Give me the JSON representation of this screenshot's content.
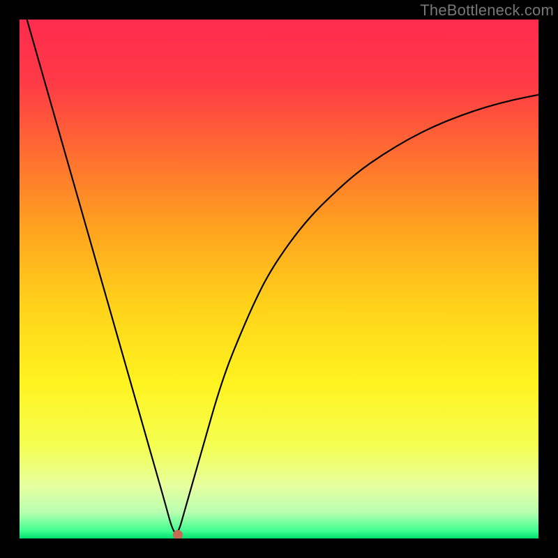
{
  "watermark": "TheBottleneck.com",
  "chart_data": {
    "type": "line",
    "title": "",
    "xlabel": "",
    "ylabel": "",
    "xlim": [
      0,
      100
    ],
    "ylim": [
      0,
      100
    ],
    "background_gradient": {
      "stops": [
        {
          "offset": 0.0,
          "color": "#ff2b4e"
        },
        {
          "offset": 0.12,
          "color": "#ff3a46"
        },
        {
          "offset": 0.25,
          "color": "#ff6a32"
        },
        {
          "offset": 0.4,
          "color": "#ffa21f"
        },
        {
          "offset": 0.55,
          "color": "#ffd21a"
        },
        {
          "offset": 0.7,
          "color": "#fff31f"
        },
        {
          "offset": 0.82,
          "color": "#f4ff50"
        },
        {
          "offset": 0.9,
          "color": "#e6ffa0"
        },
        {
          "offset": 0.95,
          "color": "#b8ffb0"
        },
        {
          "offset": 0.985,
          "color": "#40ff90"
        },
        {
          "offset": 1.0,
          "color": "#00e070"
        }
      ]
    },
    "series": [
      {
        "name": "bottleneck-curve",
        "color": "#000000",
        "stroke_width": 2.2,
        "x": [
          0,
          2,
          4,
          6,
          8,
          10,
          12,
          14,
          16,
          18,
          20,
          22,
          24,
          26,
          28,
          29.5,
          30.5,
          32,
          34,
          36,
          38,
          40,
          42,
          45,
          48,
          52,
          56,
          60,
          65,
          70,
          75,
          80,
          85,
          90,
          95,
          100
        ],
        "values": [
          105,
          98,
          91,
          84,
          77,
          70,
          63,
          56,
          49,
          42,
          35,
          28,
          21,
          14,
          7,
          1.5,
          0.7,
          6,
          13,
          20,
          27,
          33,
          38,
          45,
          51,
          57,
          62,
          66,
          70.5,
          74,
          77,
          79.5,
          81.5,
          83.2,
          84.5,
          85.5
        ]
      }
    ],
    "marker": {
      "x": 30.5,
      "y": 0.7,
      "color": "#c76a57",
      "radius": 7
    }
  }
}
